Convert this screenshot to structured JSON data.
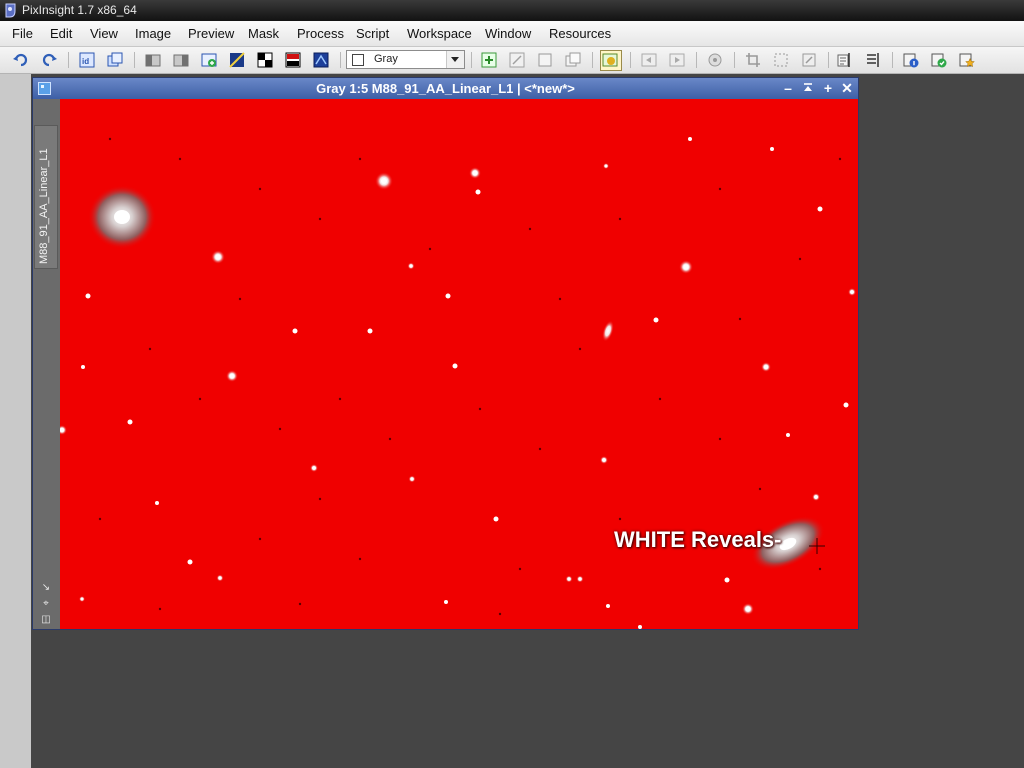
{
  "app": {
    "title": "PixInsight 1.7 x86_64"
  },
  "menu": [
    "File",
    "Edit",
    "View",
    "Image",
    "Preview",
    "Mask",
    "Process",
    "Script",
    "Workspace",
    "Window",
    "Resources"
  ],
  "toolbar": {
    "channel_select": {
      "value": "Gray",
      "options": [
        "Gray"
      ]
    },
    "buttons": [
      "undo-icon",
      "redo-icon",
      "image-identifier-icon",
      "clone-image-icon",
      "mirror-left-icon",
      "mirror-right-icon",
      "new-preview-icon",
      "stf-icon",
      "mask-display-icon",
      "color-management-icon",
      "gamut-check-icon",
      "zoom-in-icon",
      "zoom-out-icon",
      "fit-view-icon",
      "zoom-1to1-icon",
      "show-mask-icon",
      "previous-view-icon",
      "next-view-icon",
      "readout-icon",
      "crop-icon",
      "select-all-icon",
      "pan-icon",
      "image-properties-icon",
      "apply-icon",
      "favorite-icon"
    ]
  },
  "image_window": {
    "title": "Gray 1:5 M88_91_AA_Linear_L1 | <*new*>",
    "tab_label": "M88_91_AA_Linear_L1",
    "overlay_text": "WHITE Reveals-",
    "canvas_color": "#f00000",
    "mask_color_name": "red"
  },
  "colors": {
    "accent": "#3d5fa6",
    "background": "#454545"
  }
}
